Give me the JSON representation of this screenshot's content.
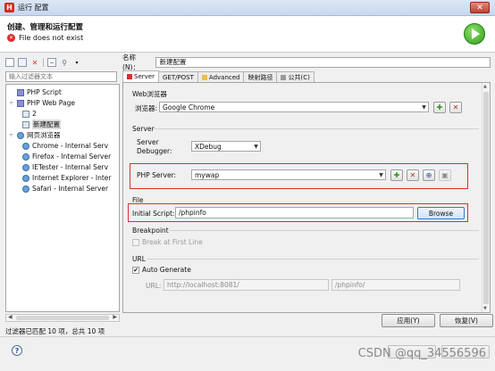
{
  "window": {
    "title": "运行 配置",
    "close_glyph": "✕",
    "app_icon": "H"
  },
  "header": {
    "title": "创建、管理和运行配置",
    "error": "File does not exist",
    "error_icon": "✕",
    "run_icon": "run-icon"
  },
  "left": {
    "filter_placeholder": "输入过滤器文本",
    "tree": [
      {
        "label": "PHP Script"
      },
      {
        "label": "PHP Web Page"
      },
      {
        "label": "2"
      },
      {
        "label": "新建配置"
      },
      {
        "label": "网页浏览器"
      },
      {
        "label": "Chrome - Internal Serv"
      },
      {
        "label": "Firefox - Internal Server"
      },
      {
        "label": "IETester - Internal Serv"
      },
      {
        "label": "Internet Explorer - Inter"
      },
      {
        "label": "Safari - Internal Server"
      }
    ],
    "status": "过滤器已匹配 10 项，总共 10 项"
  },
  "right": {
    "name_label": "名称(N)：",
    "name_value": "新建配置",
    "tabs": [
      "Server",
      "GET/POST",
      "Advanced",
      "映射路径",
      "公共(C)"
    ],
    "web_browser_group": "Web浏览器",
    "browser_label": "浏览器:",
    "browser_value": "Google Chrome",
    "server_group": "Server",
    "server_debugger_label_1": "Server",
    "server_debugger_label_2": "Debugger:",
    "debugger_value": "XDebug",
    "php_server_label": "PHP Server:",
    "php_server_value": "mywap",
    "file_group": "File",
    "initial_script_label": "Initial Script:",
    "initial_script_value": "/phpinfo",
    "browse_label": "Browse",
    "breakpoint_group": "Breakpoint",
    "break_first_line": "Break at First Line",
    "url_group": "URL",
    "auto_generate": "Auto Generate",
    "url_label": "URL:",
    "url_base": "http://localhost:8081/",
    "url_path": "/phpinfo/",
    "apply": "应用(Y)",
    "revert": "恢复(V)"
  },
  "footer": {
    "watermark": "CSDN @qq_34556596"
  }
}
